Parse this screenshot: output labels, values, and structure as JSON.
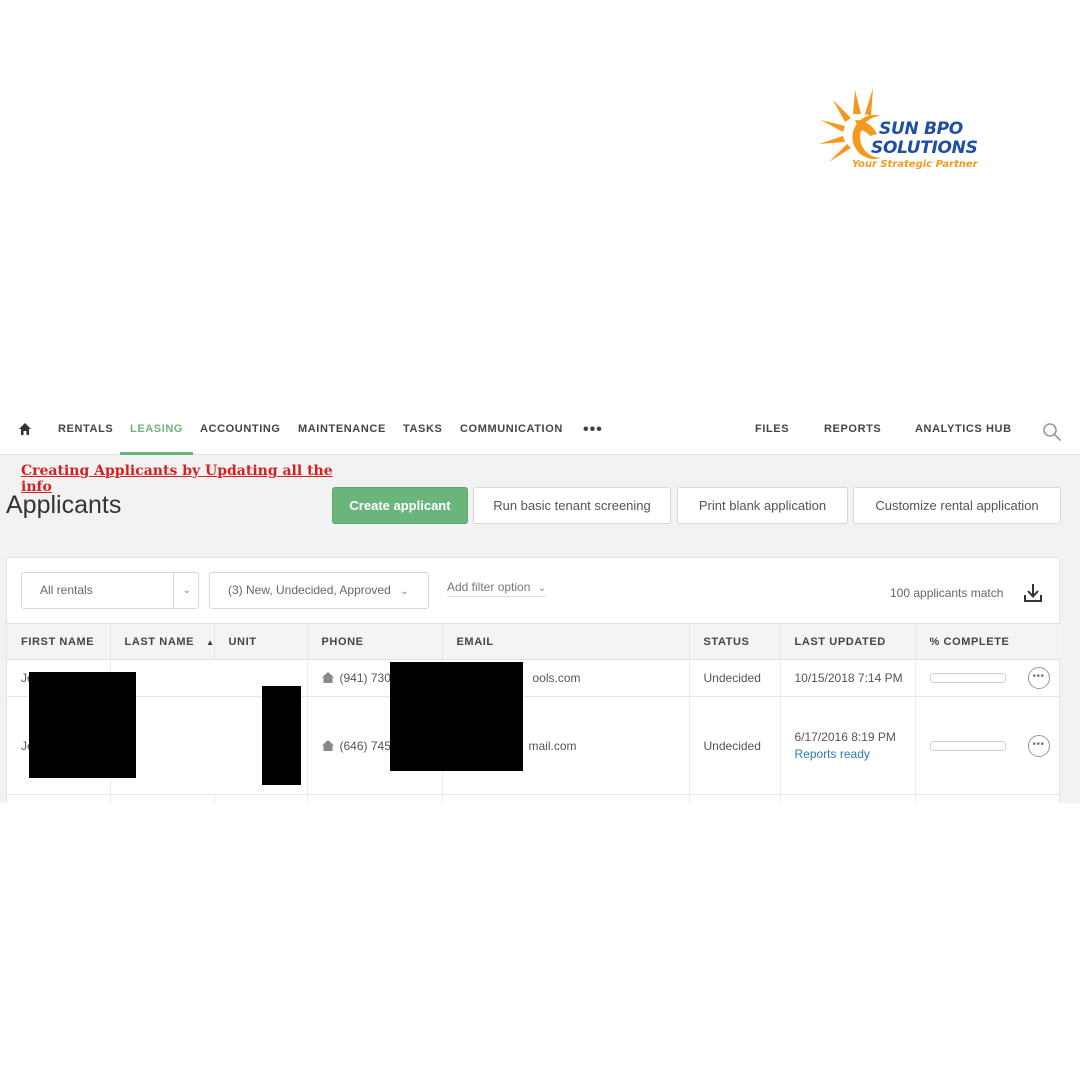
{
  "logo": {
    "line1": "SUN BPO",
    "line2": "SOLUTIONS",
    "tagline": "Your Strategic Partner",
    "sun_color": "#f39a1e",
    "text_color": "#1f4fa0"
  },
  "nav": {
    "home_icon": "home-icon",
    "items": [
      "RENTALS",
      "LEASING",
      "ACCOUNTING",
      "MAINTENANCE",
      "TASKS",
      "COMMUNICATION"
    ],
    "active": "LEASING",
    "more_icon": "•••",
    "right_items": [
      "FILES",
      "REPORTS",
      "ANALYTICS HUB"
    ],
    "search_icon": "search-icon",
    "accent_color": "#6ab57b"
  },
  "annotation": "Creating Applicants by Updating all the info",
  "page": {
    "title": "Applicants"
  },
  "actions": {
    "create": "Create applicant",
    "screening": "Run basic tenant screening",
    "print": "Print blank application",
    "customize": "Customize rental application"
  },
  "filters": {
    "rentals": "All rentals",
    "status": "(3) New, Undecided, Approved",
    "add_filter": "Add filter option",
    "match_count": "100 applicants match",
    "download_icon": "download-icon"
  },
  "table": {
    "columns": [
      "FIRST NAME",
      "LAST NAME",
      "UNIT",
      "PHONE",
      "EMAIL",
      "STATUS",
      "LAST UPDATED",
      "% COMPLETE"
    ],
    "rows": [
      {
        "first_name": "Je",
        "last_name": "",
        "unit": "",
        "phone": "(941) 730",
        "email": "ools.com",
        "status": "Undecided",
        "last_updated": "10/15/2018 7:14 PM",
        "reports": "",
        "complete": 0
      },
      {
        "first_name": "Je",
        "last_name": "",
        "unit": "",
        "phone": "(646) 745",
        "email": "mail.com",
        "status": "Undecided",
        "last_updated": "6/17/2016 8:19 PM",
        "reports": "Reports ready",
        "complete": 0
      }
    ]
  }
}
